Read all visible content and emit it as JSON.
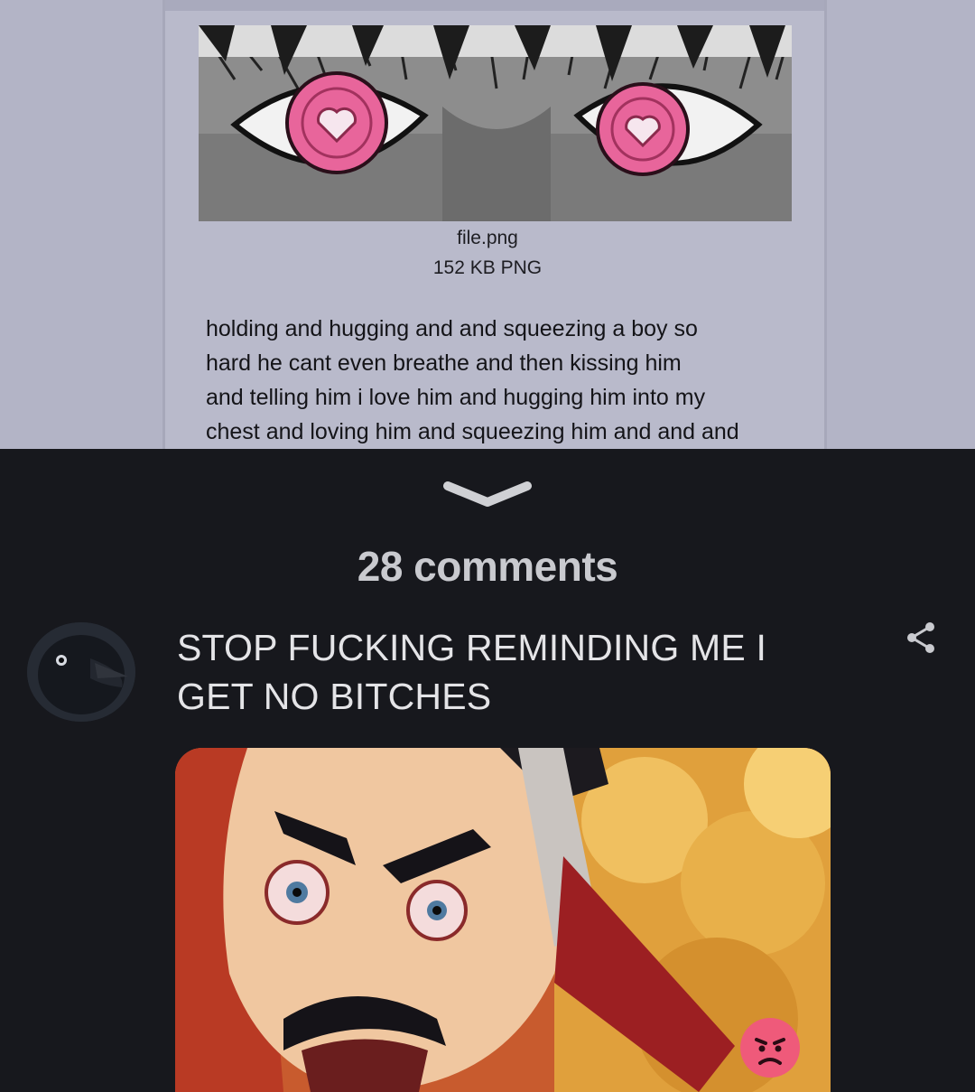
{
  "post": {
    "file_name": "file.png",
    "file_info": "152 KB PNG",
    "body_lines": [
      "holding and hugging and and squeezing a boy so",
      "hard he cant even breathe and then kissing him",
      "and telling him i love him and hugging him into my",
      "chest and loving him and squeezing him and and and"
    ]
  },
  "comments": {
    "count_label": "28 comments",
    "items": [
      {
        "avatar_icon": "crow-avatar",
        "text_lines": [
          "STOP FUCKING REMINDING ME I",
          "GET NO BITCHES"
        ],
        "reaction_icon": "angry-face-icon"
      }
    ]
  },
  "colors": {
    "background": "#17181d",
    "post_bg": "#b9bacb",
    "text_light": "#e4e4e7",
    "reaction": "#ef5a7a"
  }
}
